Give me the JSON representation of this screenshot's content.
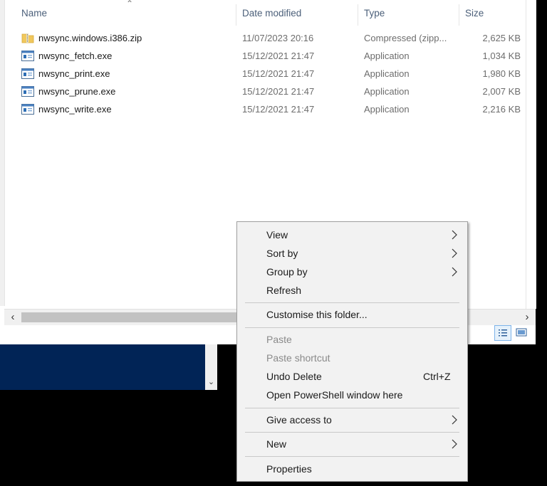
{
  "columns": {
    "name": "Name",
    "date": "Date modified",
    "type": "Type",
    "size": "Size"
  },
  "files": [
    {
      "name": "nwsync.windows.i386.zip",
      "date": "11/07/2023 20:16",
      "type": "Compressed (zipp...",
      "size": "2,625 KB",
      "icon": "zip-folder-icon"
    },
    {
      "name": "nwsync_fetch.exe",
      "date": "15/12/2021 21:47",
      "type": "Application",
      "size": "1,034 KB",
      "icon": "application-icon"
    },
    {
      "name": "nwsync_print.exe",
      "date": "15/12/2021 21:47",
      "type": "Application",
      "size": "1,980 KB",
      "icon": "application-icon"
    },
    {
      "name": "nwsync_prune.exe",
      "date": "15/12/2021 21:47",
      "type": "Application",
      "size": "2,007 KB",
      "icon": "application-icon"
    },
    {
      "name": "nwsync_write.exe",
      "date": "15/12/2021 21:47",
      "type": "Application",
      "size": "2,216 KB",
      "icon": "application-icon"
    }
  ],
  "context_menu": {
    "view": "View",
    "sort_by": "Sort by",
    "group_by": "Group by",
    "refresh": "Refresh",
    "customise": "Customise this folder...",
    "paste": "Paste",
    "paste_shortcut": "Paste shortcut",
    "undo_delete": "Undo Delete",
    "undo_shortcut": "Ctrl+Z",
    "open_powershell": "Open PowerShell window here",
    "give_access": "Give access to",
    "new": "New",
    "properties": "Properties"
  },
  "colors": {
    "highlight": "#f3ef2a",
    "powershell_bg": "#012456",
    "menu_bg": "#f2f2f2"
  }
}
